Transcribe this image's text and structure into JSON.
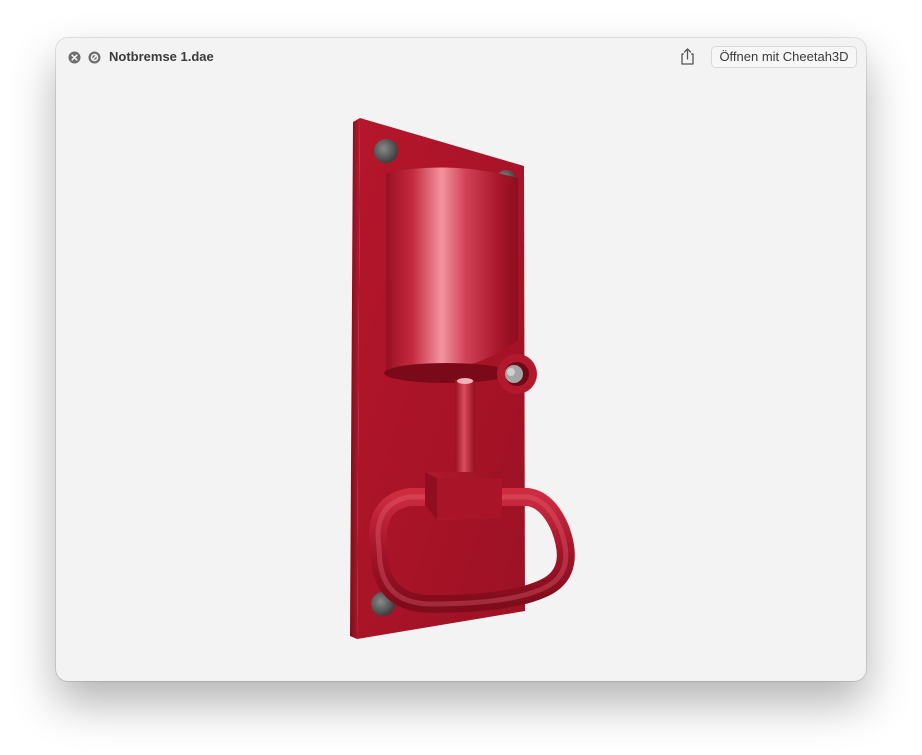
{
  "window": {
    "title": "Notbremse 1.dae",
    "open_with_label": "Öffnen mit Cheetah3D"
  },
  "toolbar": {
    "close_icon": "close-icon",
    "block_icon": "prohibit-icon",
    "share_icon": "share-icon"
  },
  "preview": {
    "model": "emergency-brake-handle",
    "model_color": "#a8142a",
    "background": "#f3f3f3"
  }
}
